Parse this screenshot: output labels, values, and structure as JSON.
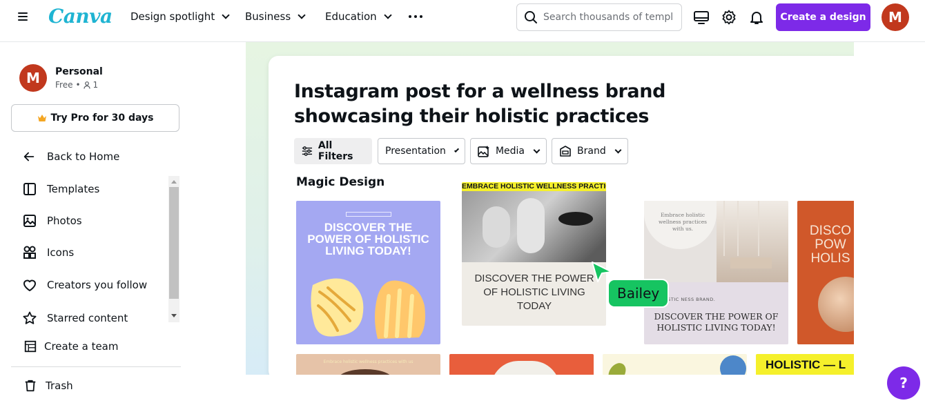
{
  "brand": {
    "logo": "Canva",
    "accent": "#7d2ae8",
    "logo_color": "#1fb4d2"
  },
  "nav": {
    "items": [
      {
        "label": "Design spotlight"
      },
      {
        "label": "Business"
      },
      {
        "label": "Education"
      }
    ],
    "more_icon": "ellipsis-icon",
    "search_placeholder": "Search thousands of templates",
    "create_label": "Create a design",
    "avatar_initial": "M"
  },
  "sidebar": {
    "account_name": "Personal",
    "account_plan": "Free",
    "member_count": "1",
    "avatar_initial": "M",
    "try_pro_label": "Try Pro for 30 days",
    "back_label": "Back to Home",
    "items": [
      {
        "label": "Templates",
        "icon": "templates-icon"
      },
      {
        "label": "Photos",
        "icon": "photo-icon"
      },
      {
        "label": "Icons",
        "icon": "shapes-icon"
      },
      {
        "label": "Creators you follow",
        "icon": "heart-icon"
      },
      {
        "label": "Starred content",
        "icon": "star-icon"
      }
    ],
    "create_team_label": "Create a team",
    "trash_label": "Trash"
  },
  "main": {
    "title": "Instagram post for a wellness brand showcasing their holistic practices",
    "filters": [
      {
        "label": "All Filters"
      },
      {
        "label": "Presentation"
      },
      {
        "label": "Media"
      },
      {
        "label": "Brand"
      }
    ],
    "section_label": "Magic Design",
    "cards": [
      {
        "text": "DISCOVER THE POWER OF HOLISTIC LIVING TODAY!",
        "bg": "#a4a8f2"
      },
      {
        "banner": "EMBRACE HOLISTIC WELLNESS PRACTICES",
        "text": "DISCOVER THE POWER OF HOLISTIC LIVING TODAY"
      },
      {
        "top_text": "Embrace holistic wellness practices with us.",
        "small": "GS HOLISTIC NESS BRAND.",
        "text": "DISCOVER THE POWER OF HOLISTIC LIVING TODAY!"
      },
      {
        "text": "DISCO POW HOLIS",
        "bg": "#d0582a"
      }
    ],
    "row2": [
      {
        "text": "Embrace holistic wellness practices with us"
      },
      {
        "text": ""
      },
      {
        "text": ""
      },
      {
        "text": "HOLISTIC — L"
      }
    ],
    "cursor_label": "Bailey"
  },
  "help_label": "?"
}
